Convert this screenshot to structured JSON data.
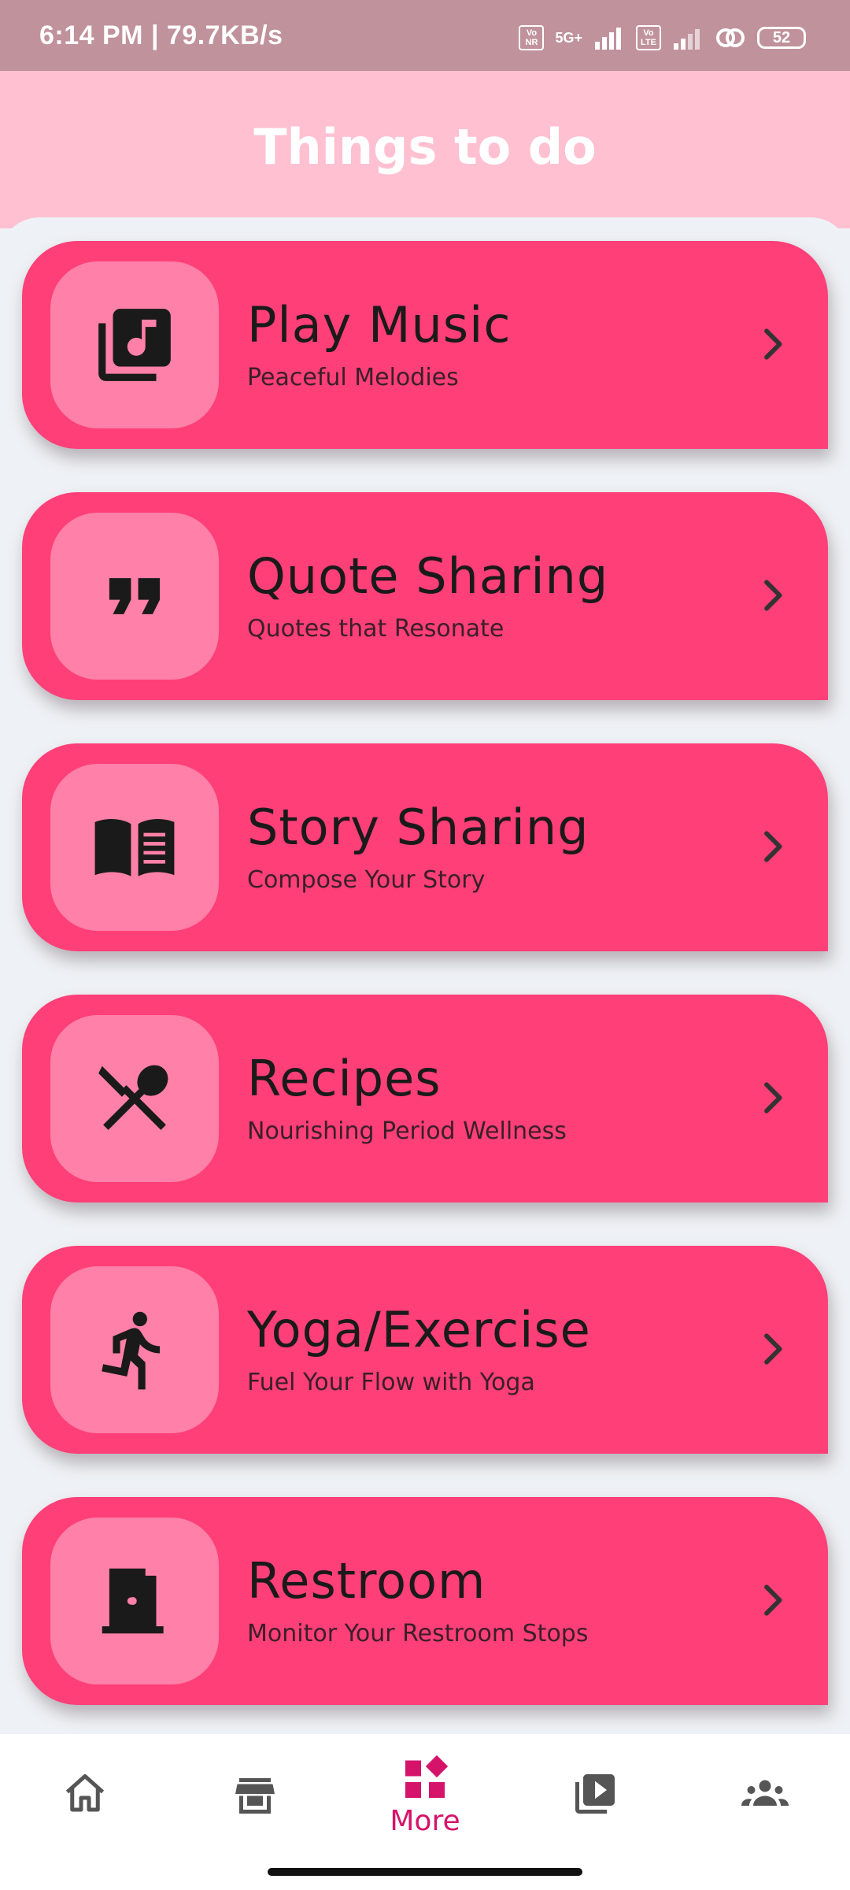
{
  "status_bar": {
    "time_speed": "6:14 PM | 79.7KB/s",
    "chip1": "Vo NR",
    "network1": "5G+",
    "chip2": "Vo LTE",
    "battery": "52"
  },
  "header": {
    "title": "Things to do"
  },
  "colors": {
    "card": "#ff3f78",
    "icon_box": "#ff80a8",
    "header": "#ffc0d2",
    "accent": "#d6136a"
  },
  "cards": [
    {
      "title": "Play Music",
      "subtitle": "Peaceful Melodies",
      "icon": "music-library-icon"
    },
    {
      "title": "Quote Sharing",
      "subtitle": "Quotes that Resonate",
      "icon": "format-quote-icon"
    },
    {
      "title": "Story Sharing",
      "subtitle": "Compose Your Story",
      "icon": "open-book-icon"
    },
    {
      "title": "Recipes",
      "subtitle": "Nourishing Period Wellness",
      "icon": "utensils-icon"
    },
    {
      "title": "Yoga/Exercise",
      "subtitle": "Fuel Your Flow with Yoga",
      "icon": "running-person-icon"
    },
    {
      "title": "Restroom",
      "subtitle": "Monitor Your Restroom Stops",
      "icon": "door-icon"
    }
  ],
  "bottom_nav": {
    "items": [
      {
        "icon": "home-icon"
      },
      {
        "icon": "store-icon"
      },
      {
        "icon": "dashboard-icon",
        "label": "More",
        "selected": true
      },
      {
        "icon": "video-library-icon"
      },
      {
        "icon": "groups-icon"
      }
    ]
  }
}
